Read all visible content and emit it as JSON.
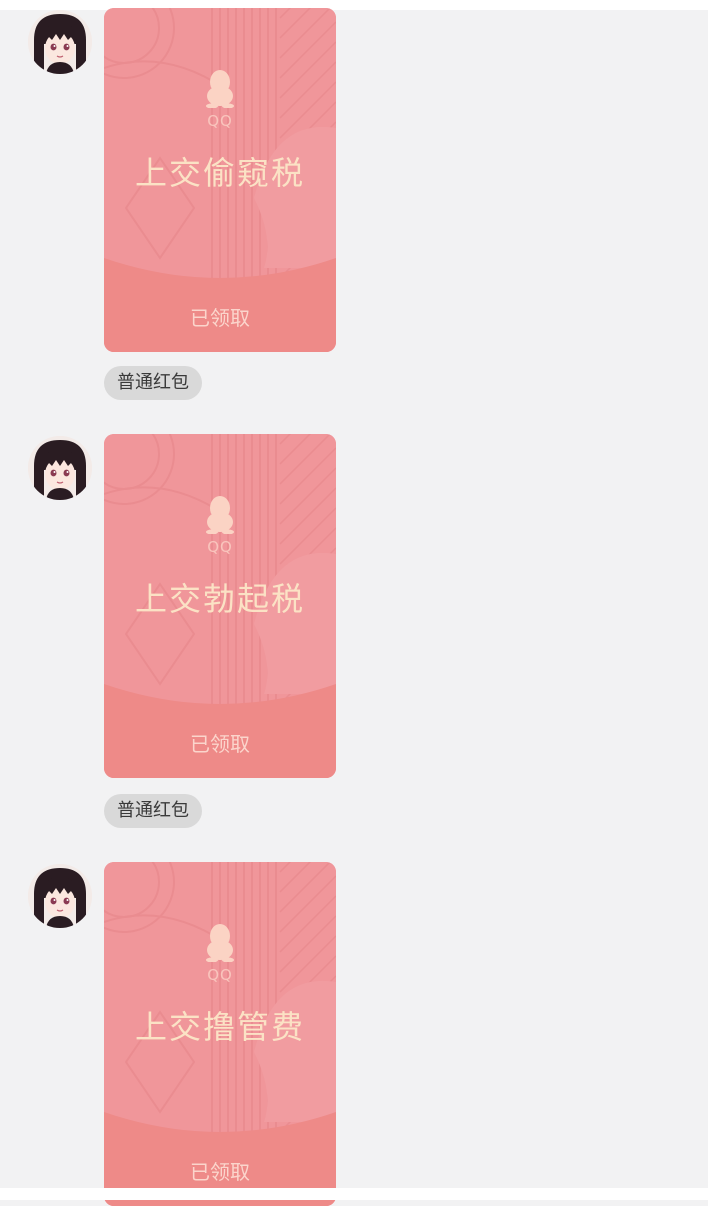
{
  "messages": [
    {
      "wish_text": "上交偷窥税",
      "brand": "QQ",
      "status": "已领取",
      "type_label": "普通红包"
    },
    {
      "wish_text": "上交勃起税",
      "brand": "QQ",
      "status": "已领取",
      "type_label": "普通红包"
    },
    {
      "wish_text": "上交撸管费",
      "brand": "QQ",
      "status": "已领取"
    }
  ],
  "colors": {
    "packet_bg": "#f0969a",
    "packet_bottom": "#ee8a88",
    "wish_text": "#fbe2c5",
    "tag_bg": "#d9d9d9",
    "page_bg": "#f2f2f3"
  },
  "icons": {
    "avatar": "anime-girl-avatar",
    "brand_logo": "qq-penguin-icon"
  }
}
